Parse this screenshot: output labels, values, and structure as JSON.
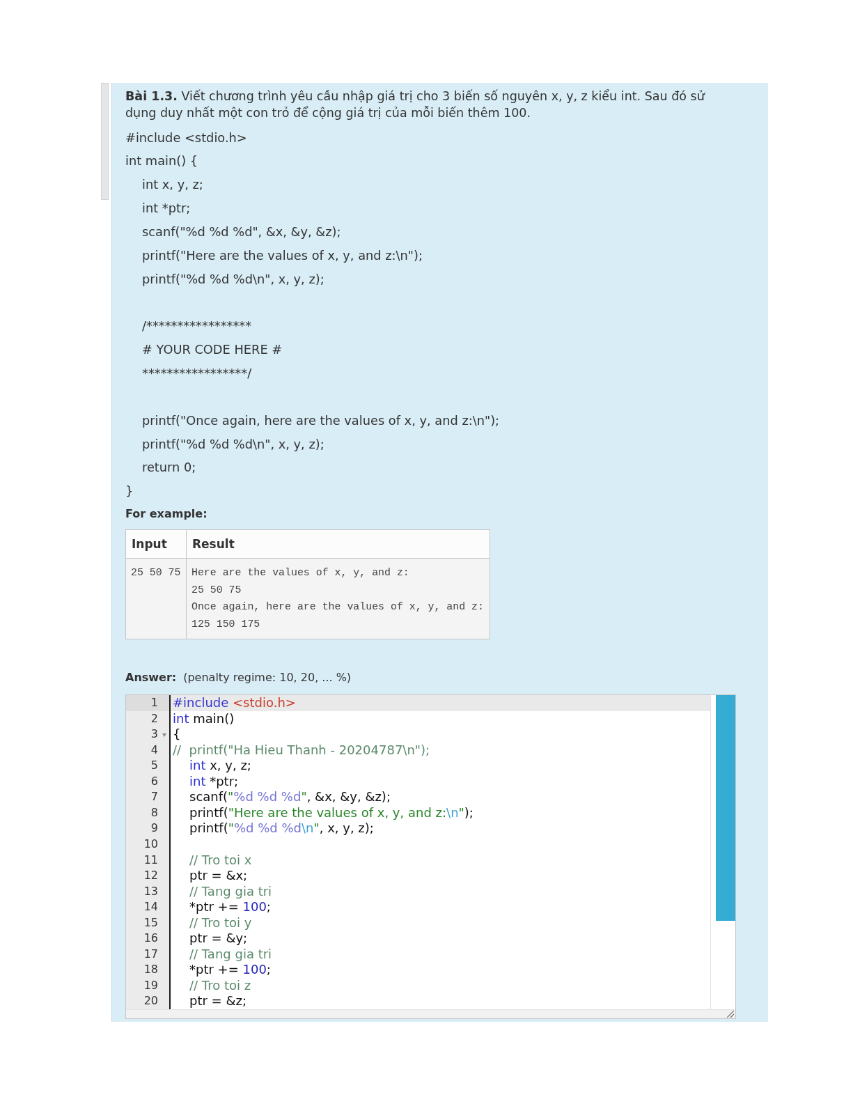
{
  "problem": {
    "statement": "**Bài 1.3.** Viết chương trình yêu cầu nhập giá trị cho 3 biến số nguyên x, y, z kiểu int. Sau đó sử dụng duy nhất một con trỏ để cộng giá trị của mỗi biến thêm 100.",
    "sample_code": [
      {
        "text": "#include <stdio.h>"
      },
      {
        "text": "int main() {",
        "children": [
          {
            "lines": [
              "int x, y, z;",
              "int *ptr;",
              "scanf(\"%d %d %d\", &x, &y, &z);",
              "printf(\"Here are the values of x, y, and z:\\n\");",
              "printf(\"%d %d %d\\n\", x, y, z);"
            ]
          },
          {
            "lines": [
              "/*****************",
              "# YOUR CODE HERE #",
              "*****************/"
            ]
          },
          {
            "lines": [
              "printf(\"Once again, here are the values of x, y, and z:\\n\");",
              "printf(\"%d %d %d\\n\", x, y, z);",
              "return 0;"
            ]
          }
        ]
      },
      {
        "text": "}"
      }
    ]
  },
  "example": {
    "label": "For example:",
    "columns": [
      "Input",
      "Result"
    ],
    "rows": [
      {
        "input": "25 50 75",
        "result": "Here are the values of x, y, and z:\n25 50 75\nOnce again, here are the values of x, y, and z:\n125 150 175"
      }
    ]
  },
  "answer": {
    "label": "Answer:",
    "penalty": "(penalty regime: 10, 20, ... %)",
    "editor": {
      "lines": [
        {
          "number": "1",
          "active": true,
          "indented": false,
          "tokens": [
            {
              "kind": "preproc",
              "text": "#include "
            },
            {
              "kind": "header",
              "text": "<stdio.h>"
            }
          ]
        },
        {
          "number": "2",
          "active": false,
          "indented": false,
          "tokens": [
            {
              "kind": "keyword",
              "text": "int"
            },
            {
              "kind": "plain",
              "text": " main()"
            }
          ]
        },
        {
          "number": "3",
          "active": false,
          "indented": false,
          "expanded": true,
          "tokens": [
            {
              "kind": "plain",
              "text": "{"
            }
          ]
        },
        {
          "number": "4",
          "active": false,
          "indented": false,
          "tokens": [
            {
              "kind": "comment",
              "text": "//  printf(\"Ha Hieu Thanh - 20204787\\n\");"
            }
          ]
        },
        {
          "number": "5",
          "active": false,
          "indented": true,
          "tokens": [
            {
              "kind": "keyword",
              "text": "int"
            },
            {
              "kind": "plain",
              "text": " x, y, z;"
            }
          ]
        },
        {
          "number": "6",
          "active": false,
          "indented": true,
          "tokens": [
            {
              "kind": "keyword",
              "text": "int"
            },
            {
              "kind": "plain",
              "text": " *ptr;"
            }
          ]
        },
        {
          "number": "7",
          "active": false,
          "indented": true,
          "tokens": [
            {
              "kind": "plain",
              "text": "scanf("
            },
            {
              "kind": "string",
              "text": "\""
            },
            {
              "kind": "format",
              "text": "%d %d %d"
            },
            {
              "kind": "string",
              "text": "\""
            },
            {
              "kind": "plain",
              "text": ", &x, &y, &z);"
            }
          ]
        },
        {
          "number": "8",
          "active": false,
          "indented": true,
          "tokens": [
            {
              "kind": "plain",
              "text": "printf("
            },
            {
              "kind": "string",
              "text": "\"Here are the values of x, y, and z:"
            },
            {
              "kind": "escape",
              "text": "\\n"
            },
            {
              "kind": "string",
              "text": "\""
            },
            {
              "kind": "plain",
              "text": ");"
            }
          ]
        },
        {
          "number": "9",
          "active": false,
          "indented": true,
          "tokens": [
            {
              "kind": "plain",
              "text": "printf("
            },
            {
              "kind": "string",
              "text": "\""
            },
            {
              "kind": "format",
              "text": "%d %d %d"
            },
            {
              "kind": "escape",
              "text": "\\n"
            },
            {
              "kind": "string",
              "text": "\""
            },
            {
              "kind": "plain",
              "text": ", x, y, z);"
            }
          ]
        },
        {
          "number": "10",
          "active": false
        },
        {
          "number": "11",
          "active": false,
          "indented": true,
          "tokens": [
            {
              "kind": "comment",
              "text": "// Tro toi x"
            }
          ]
        },
        {
          "number": "12",
          "active": false,
          "indented": true,
          "tokens": [
            {
              "kind": "plain",
              "text": "ptr = &x;"
            }
          ]
        },
        {
          "number": "13",
          "active": false,
          "indented": true,
          "tokens": [
            {
              "kind": "comment",
              "text": "// Tang gia tri"
            }
          ]
        },
        {
          "number": "14",
          "active": false,
          "indented": true,
          "tokens": [
            {
              "kind": "plain",
              "text": "*ptr += "
            },
            {
              "kind": "number",
              "text": "100"
            },
            {
              "kind": "plain",
              "text": ";"
            }
          ]
        },
        {
          "number": "15",
          "active": false,
          "indented": true,
          "tokens": [
            {
              "kind": "comment",
              "text": "// Tro toi y"
            }
          ]
        },
        {
          "number": "16",
          "active": false,
          "indented": true,
          "tokens": [
            {
              "kind": "plain",
              "text": "ptr = &y;"
            }
          ]
        },
        {
          "number": "17",
          "active": false,
          "indented": true,
          "tokens": [
            {
              "kind": "comment",
              "text": "// Tang gia tri"
            }
          ]
        },
        {
          "number": "18",
          "active": false,
          "indented": true,
          "tokens": [
            {
              "kind": "plain",
              "text": "*ptr += "
            },
            {
              "kind": "number",
              "text": "100"
            },
            {
              "kind": "plain",
              "text": ";"
            }
          ]
        },
        {
          "number": "19",
          "active": false,
          "indented": true,
          "tokens": [
            {
              "kind": "comment",
              "text": "// Tro toi z"
            }
          ]
        },
        {
          "number": "20",
          "active": false,
          "indented": true,
          "tokens": [
            {
              "kind": "plain",
              "text": "ptr = &z;"
            }
          ]
        }
      ]
    }
  }
}
